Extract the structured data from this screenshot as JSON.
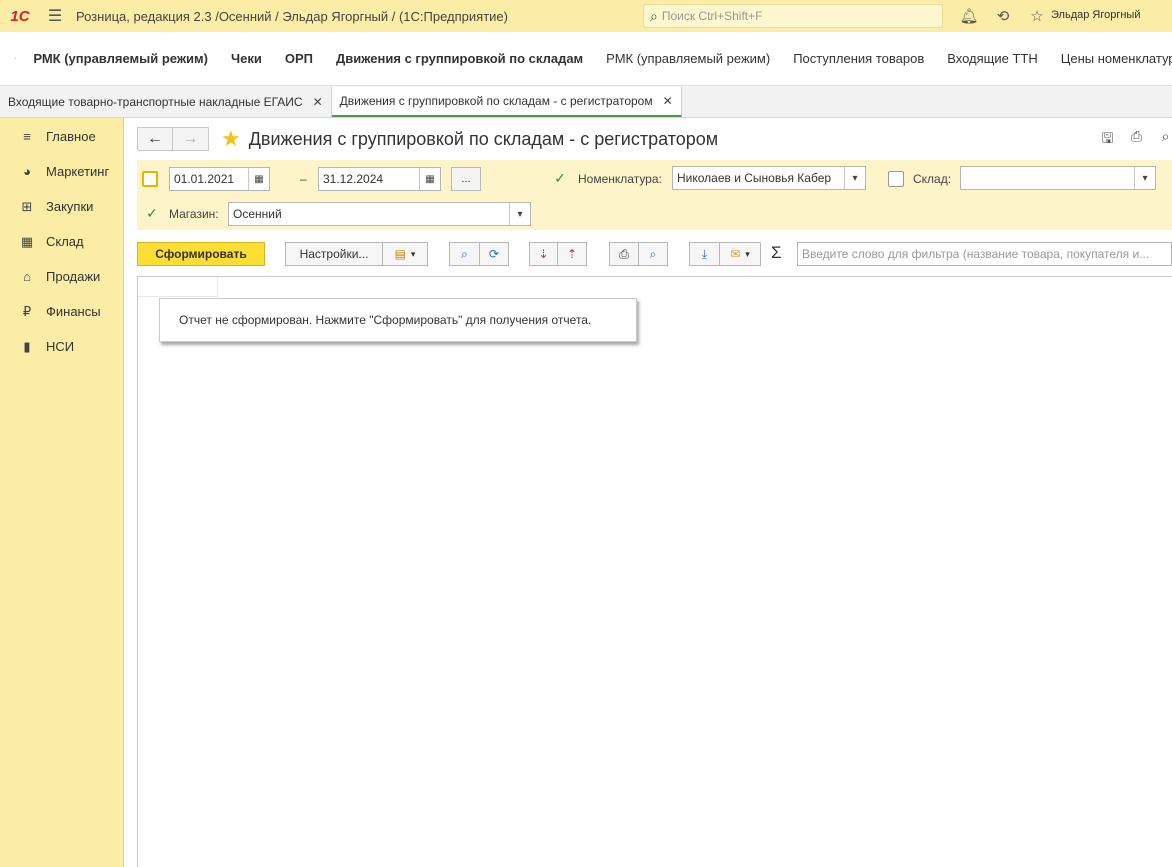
{
  "titlebar": {
    "logo": "1С",
    "app_title": "Розница, редакция 2.3 /Осенний / Эльдар Ягоргный /  (1С:Предприятие)",
    "search_placeholder": "Поиск Ctrl+Shift+F",
    "user": "Эльдар Ягоргный"
  },
  "topnav": {
    "items": [
      {
        "label": "РМК (управляемый режим)",
        "bold": true
      },
      {
        "label": "Чеки",
        "bold": true
      },
      {
        "label": "ОРП",
        "bold": true
      },
      {
        "label": "Движения с группировкой по складам",
        "bold": true
      },
      {
        "label": "РМК (управляемый режим)",
        "bold": false
      },
      {
        "label": "Поступления товаров",
        "bold": false
      },
      {
        "label": "Входящие ТТН",
        "bold": false
      },
      {
        "label": "Цены номенклатуры",
        "bold": false
      }
    ]
  },
  "open_tabs": [
    {
      "label": "Входящие товарно-транспортные накладные ЕГАИС",
      "active": false
    },
    {
      "label": "Движения с группировкой по складам - с регистратором",
      "active": true
    }
  ],
  "sidebar": {
    "items": [
      {
        "label": "Главное",
        "icon": "menu-lines-icon"
      },
      {
        "label": "Маркетинг",
        "icon": "pie-chart-icon"
      },
      {
        "label": "Закупки",
        "icon": "cart-icon"
      },
      {
        "label": "Склад",
        "icon": "grid-icon"
      },
      {
        "label": "Продажи",
        "icon": "basket-icon"
      },
      {
        "label": "Финансы",
        "icon": "ruble-icon"
      },
      {
        "label": "НСИ",
        "icon": "book-icon"
      }
    ]
  },
  "form": {
    "title": "Движения с группировкой по складам - с регистратором",
    "params": {
      "period_checked": false,
      "date_from": "01.01.2021",
      "date_separator": "–",
      "date_to": "31.12.2024",
      "dots_label": "...",
      "nomenclature_checked": true,
      "nomenclature_label": "Номенклатура:",
      "nomenclature_value": "Николаев и Сыновья Кабер",
      "warehouse_checked": false,
      "warehouse_label": "Склад:",
      "warehouse_value": "",
      "store_checked": true,
      "store_label": "Магазин:",
      "store_value": "Осенний"
    },
    "commands": {
      "generate": "Сформировать",
      "settings": "Настройки...",
      "sigma": "Σ",
      "filter_placeholder": "Введите слово для фильтра (название товара, покупателя и..."
    },
    "notice": "Отчет не сформирован. Нажмите \"Сформировать\" для получения отчета."
  },
  "colors": {
    "accent_yellow": "#fbeda6",
    "button_primary": "#fcde34",
    "check_green": "#2e8b3c",
    "logo_red": "#d2232a"
  }
}
